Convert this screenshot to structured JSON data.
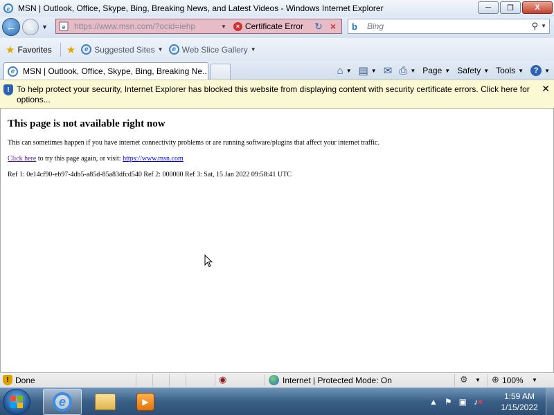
{
  "window": {
    "title": "MSN | Outlook, Office, Skype, Bing, Breaking News, and Latest Videos - Windows Internet Explorer",
    "minimize": "─",
    "maximize": "❐",
    "close": "X"
  },
  "address": {
    "url": "https://www.msn.com/?ocid=iehp",
    "cert_error": "Certificate Error"
  },
  "search": {
    "placeholder": "Bing"
  },
  "favorites_bar": {
    "favorites": "Favorites",
    "links": [
      {
        "label": "Suggested Sites"
      },
      {
        "label": "Web Slice Gallery"
      }
    ]
  },
  "tabs": [
    {
      "label": "MSN | Outlook, Office, Skype, Bing, Breaking Ne..."
    }
  ],
  "command_bar": {
    "page": "Page",
    "safety": "Safety",
    "tools": "Tools",
    "help": "?"
  },
  "info_bar": {
    "message": "To help protect your security, Internet Explorer has blocked this website from displaying content with security certificate errors. Click here for options..."
  },
  "content": {
    "heading": "This page is not available right now",
    "para1": "This can sometimes happen if you have internet connectivity problems or are running software/plugins that affect your internet traffic.",
    "click_here": "Click here",
    "para2_mid": " to try this page again, or visit: ",
    "msn_link": "https://www.msn.com",
    "refs": "Ref 1: 0e14cf90-eb97-4db5-a85d-85a83dfcd540    Ref 2: 000000    Ref 3: Sat, 15 Jan 2022 09:58:41 UTC"
  },
  "status_bar": {
    "done": "Done",
    "zone": "Internet | Protected Mode: On",
    "zoom": "100%"
  },
  "taskbar": {
    "time": "1:59 AM",
    "date": "1/15/2022"
  }
}
